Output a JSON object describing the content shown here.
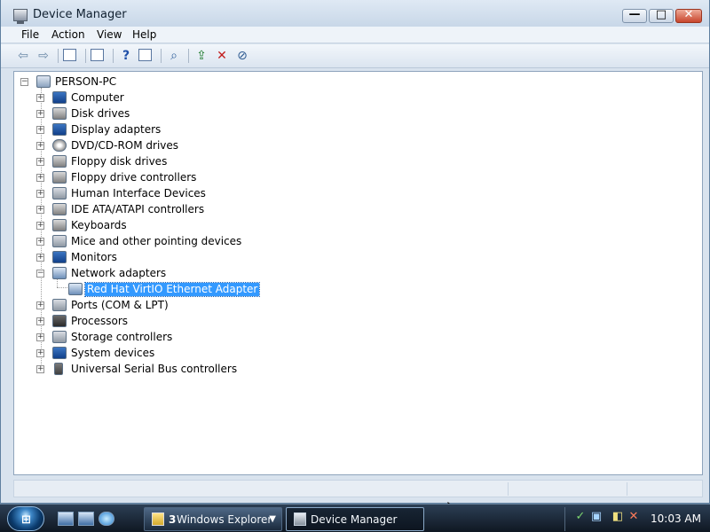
{
  "window": {
    "title": "Device Manager",
    "controls": {
      "minimize_icon": "minimize-icon",
      "maximize_icon": "maximize-icon",
      "close_icon": "close-icon"
    }
  },
  "menu": [
    "File",
    "Action",
    "View",
    "Help"
  ],
  "toolbar": {
    "buttons": [
      {
        "name": "back-button",
        "icon": "arrow-left-icon"
      },
      {
        "name": "forward-button",
        "icon": "arrow-right-icon"
      },
      {
        "name": "show-hide-console-tree-button",
        "icon": "console-tree-icon"
      },
      {
        "name": "properties-button",
        "icon": "properties-icon"
      },
      {
        "name": "help-button",
        "icon": "help-icon"
      },
      {
        "name": "show-hide-action-pane-button",
        "icon": "action-pane-icon"
      },
      {
        "name": "scan-hardware-button",
        "icon": "scan-hardware-icon"
      },
      {
        "name": "update-driver-button",
        "icon": "update-driver-icon"
      },
      {
        "name": "uninstall-button",
        "icon": "uninstall-icon"
      },
      {
        "name": "disable-button",
        "icon": "disable-icon"
      }
    ]
  },
  "tree": {
    "root": "PERSON-PC",
    "items": [
      "Computer",
      "Disk drives",
      "Display adapters",
      "DVD/CD-ROM drives",
      "Floppy disk drives",
      "Floppy drive controllers",
      "Human Interface Devices",
      "IDE ATA/ATAPI controllers",
      "Keyboards",
      "Mice and other pointing devices",
      "Monitors",
      "Network adapters",
      "Ports (COM & LPT)",
      "Processors",
      "Storage controllers",
      "System devices",
      "Universal Serial Bus controllers"
    ],
    "network_child": "Red Hat VirtIO Ethernet Adapter"
  },
  "taskbar": {
    "windows_explorer_count": "3",
    "windows_explorer_label": "Windows Explorer",
    "device_manager_label": "Device Manager",
    "clock": "10:03 AM",
    "colors": {
      "selection": "#3399ff"
    }
  }
}
